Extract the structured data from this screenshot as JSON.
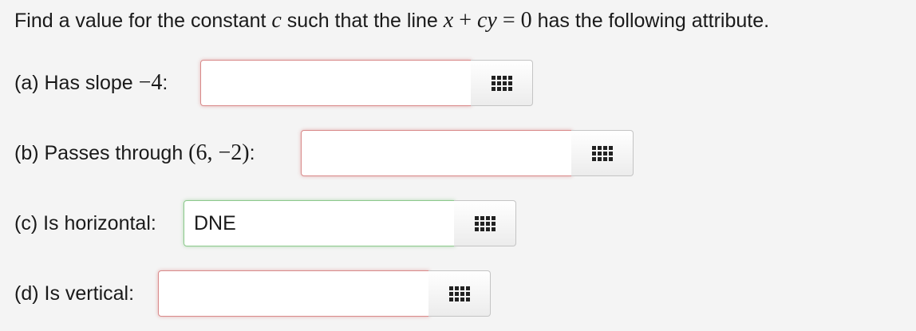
{
  "question": {
    "prefix": "Find a value for the constant ",
    "var_c": "c",
    "middle": " such that the line ",
    "eq_x": "x",
    "eq_plus": " + ",
    "eq_cy": "cy",
    "eq_rest": " = 0",
    "suffix": " has the following attribute."
  },
  "parts": [
    {
      "label_text": "(a) Has slope ",
      "label_math": "−4",
      "label_end": ":",
      "value": "",
      "status": "incorrect"
    },
    {
      "label_text": "(b) Passes through ",
      "label_math": "(6, −2)",
      "label_end": ":",
      "value": "",
      "status": "incorrect"
    },
    {
      "label_text": "(c) Is horizontal:",
      "label_math": "",
      "label_end": "",
      "value": "DNE",
      "status": "correct"
    },
    {
      "label_text": "(d) Is vertical:",
      "label_math": "",
      "label_end": "",
      "value": "",
      "status": "incorrect"
    }
  ],
  "colors": {
    "incorrect_border": "#d98a8a",
    "correct_border": "#8cc98c",
    "background": "#f4f4f4"
  },
  "icons": {
    "palette": "grid-keypad-icon"
  }
}
